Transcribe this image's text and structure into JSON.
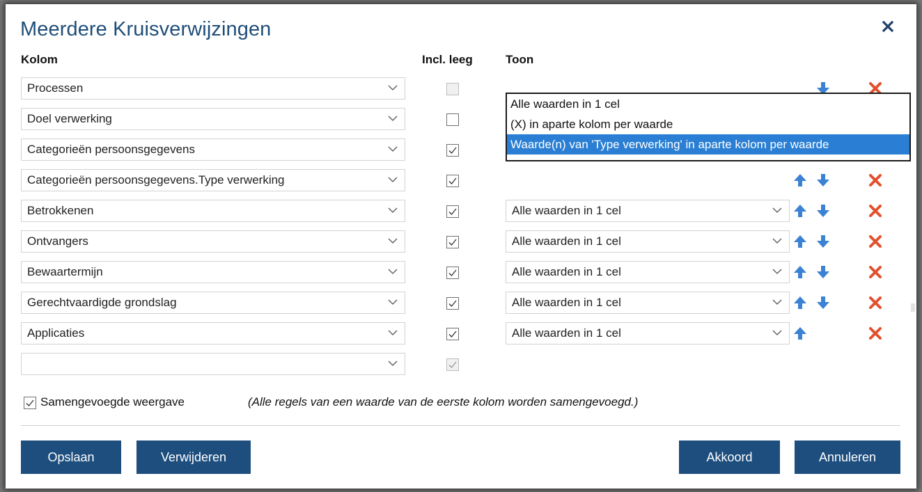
{
  "dialog": {
    "title": "Meerdere Kruisverwijzingen",
    "close_icon": "close-icon"
  },
  "headers": {
    "kolom": "Kolom",
    "incl_leeg": "Incl. leeg",
    "toon": "Toon"
  },
  "rows": [
    {
      "kolom": "Processen",
      "incl_leeg": false,
      "incl_disabled": true,
      "toon": "",
      "up": false,
      "down": true,
      "delete": true
    },
    {
      "kolom": "Doel verwerking",
      "incl_leeg": false,
      "incl_disabled": false,
      "toon": "",
      "up": false,
      "down": false,
      "delete": false
    },
    {
      "kolom": "Categorieën persoonsgegevens",
      "incl_leeg": true,
      "incl_disabled": false,
      "toon": "",
      "up": false,
      "down": false,
      "delete": false
    },
    {
      "kolom": "Categorieën persoonsgegevens.Type verwerking",
      "incl_leeg": true,
      "incl_disabled": false,
      "toon": "",
      "up": true,
      "down": true,
      "delete": true
    },
    {
      "kolom": "Betrokkenen",
      "incl_leeg": true,
      "incl_disabled": false,
      "toon": "Alle waarden in 1 cel",
      "up": true,
      "down": true,
      "delete": true
    },
    {
      "kolom": "Ontvangers",
      "incl_leeg": true,
      "incl_disabled": false,
      "toon": "Alle waarden in 1 cel",
      "up": true,
      "down": true,
      "delete": true
    },
    {
      "kolom": "Bewaartermijn",
      "incl_leeg": true,
      "incl_disabled": false,
      "toon": "Alle waarden in 1 cel",
      "up": true,
      "down": true,
      "delete": true
    },
    {
      "kolom": "Gerechtvaardigde grondslag",
      "incl_leeg": true,
      "incl_disabled": false,
      "toon": "Alle waarden in 1 cel",
      "up": true,
      "down": true,
      "delete": true
    },
    {
      "kolom": "Applicaties",
      "incl_leeg": true,
      "incl_disabled": false,
      "toon": "Alle waarden in 1 cel",
      "up": true,
      "down": false,
      "delete": true
    },
    {
      "kolom": "",
      "incl_leeg": true,
      "incl_disabled": true,
      "toon": "",
      "up": false,
      "down": false,
      "delete": false
    }
  ],
  "toon_dropdown_open": {
    "options": [
      "Alle waarden in 1 cel",
      "(X) in aparte kolom per waarde",
      "Waarde(n) van 'Type verwerking' in aparte kolom per waarde"
    ],
    "highlighted_index": 2
  },
  "merge": {
    "checked": true,
    "label": "Samengevoegde weergave",
    "note": "(Alle regels van een waarde van de eerste kolom worden samengevoegd.)"
  },
  "buttons": {
    "save": "Opslaan",
    "delete": "Verwijderen",
    "ok": "Akkoord",
    "cancel": "Annuleren"
  },
  "icons": {
    "dropdown": "chevron-down-icon",
    "up": "arrow-up-icon",
    "down": "arrow-down-icon",
    "remove": "delete-x-icon",
    "check": "checkmark-icon"
  },
  "colors": {
    "title": "#1f4e79",
    "button_bg": "#1d4e7e",
    "arrow": "#3b82d4",
    "delete": "#e2502d",
    "highlight": "#2a7fd4"
  }
}
